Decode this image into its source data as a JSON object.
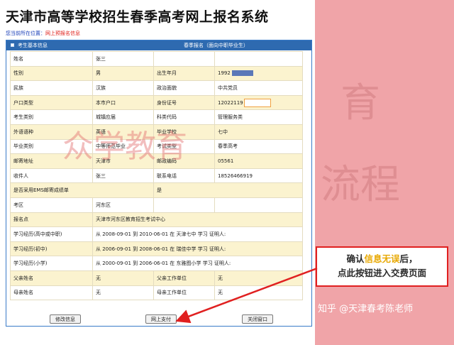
{
  "page": {
    "title": "天津市高等学校招生春季高考网上报名系统",
    "breadcrumb_label": "您当前所在位置：",
    "breadcrumb_current": "网上预报名信息"
  },
  "panel": {
    "left_header": "考生基本信息",
    "right_header": "春季报名（面向中职毕业生）"
  },
  "form": {
    "rows": [
      [
        "姓名",
        "张三",
        "",
        ""
      ],
      [
        "性别",
        "男",
        "出生年月",
        "1992"
      ],
      [
        "民族",
        "汉族",
        "政治面貌",
        "中共党员"
      ],
      [
        "户口类型",
        "本市户口",
        "身份证号",
        "12022119"
      ],
      [
        "考生类别",
        "城镇应届",
        "科类代码",
        "管理服务类"
      ],
      [
        "外语语种",
        "英语",
        "毕业学校",
        "七中"
      ],
      [
        "毕业类别",
        "中等师范毕业",
        "考试类型",
        "春季高考"
      ],
      [
        "邮寄地址",
        "天津市",
        "邮政编码",
        "05561"
      ],
      [
        "收件人",
        "张三",
        "联系电话",
        "18526466919"
      ],
      [
        "是否采用EMS邮寄成绩单",
        "",
        "是",
        ""
      ],
      [
        "考区",
        "河东区",
        "",
        ""
      ],
      [
        "报名点",
        "天津市河东区教育招生考试中心",
        "",
        ""
      ],
      [
        "学习经历(高中或中职)",
        "从 2008-09-01 到 2010-06-01 在 天津七中 学习 证明人:",
        "",
        ""
      ],
      [
        "学习经历(初中)",
        "从 2006-09-01 到 2008-06-01 在 瑞佳中学 学习 证明人:",
        "",
        ""
      ],
      [
        "学习经历(小学)",
        "从 2000-09-01 到 2006-06-01 在 东雅图小学 学习 证明人:",
        "",
        ""
      ],
      [
        "父亲姓名",
        "无",
        "父亲工作单位",
        "无"
      ],
      [
        "母亲姓名",
        "无",
        "母亲工作单位",
        "无"
      ]
    ]
  },
  "buttons": {
    "modify": "修改信息",
    "pay": "网上支付",
    "close": "关闭窗口"
  },
  "watermarks": {
    "center": "众学教育",
    "right_top": "育",
    "right_mid": "流程"
  },
  "callout": {
    "line1_pre": "确认",
    "line1_em": "信息无误",
    "line1_post": "后，",
    "line2": "点此按钮进入交费页面"
  },
  "credit": "知乎 @天津春考陈老师",
  "colors": {
    "background": "#f0a4a8",
    "header_blue": "#2e6ab0",
    "row_yellow": "#fbf3cf",
    "callout_red": "#e02020",
    "callout_emphasis": "#e8a800"
  }
}
